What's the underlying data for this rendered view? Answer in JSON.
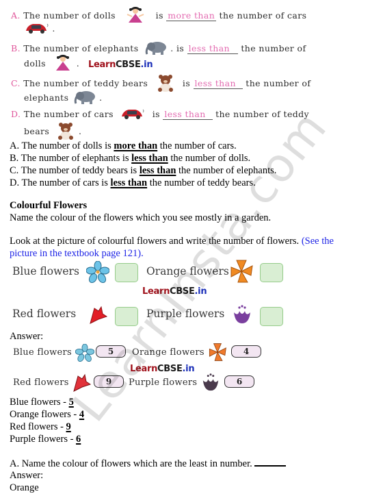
{
  "comparison_questions": [
    {
      "letter": "A.",
      "pre": "The number of dolls",
      "is": "is",
      "fill": "more than",
      "post": "the number of cars",
      "tail": "."
    },
    {
      "letter": "B.",
      "pre": "The number of elephants",
      "is": ". is",
      "fill": "less than",
      "post": "the number of",
      "line2": "dolls",
      "tail": "."
    },
    {
      "letter": "C.",
      "pre": "The number of teddy bears",
      "is": "is",
      "fill": "less than",
      "post": "the number of",
      "line2": "elephants",
      "tail": "."
    },
    {
      "letter": "D.",
      "pre": "The number of cars",
      "is": "is",
      "fill": "less than",
      "post": "the number of teddy",
      "line2": "bears",
      "tail": "."
    }
  ],
  "watermark_logo": {
    "part1": "Learn",
    "part2": "CBSE",
    "part3": ".in"
  },
  "comparison_answers": [
    {
      "pre": "A. The number of dolls is ",
      "ans": "more than",
      "post": " the number of cars."
    },
    {
      "pre": "B. The number of elephants is ",
      "ans": "less than",
      "post": " the number of dolls."
    },
    {
      "pre": "C. The number of teddy bears is ",
      "ans": "less than",
      "post": " the number of elephants."
    },
    {
      "pre": "D. The number of cars is ",
      "ans": "less than",
      "post": " the number of teddy bears."
    }
  ],
  "flowers_section": {
    "heading": "Colourful Flowers",
    "prompt": "Name the colour of the flowers which you see mostly in a garden.",
    "instruction": "Look at the picture of colourful flowers and write the number of flowers.",
    "reference_line1": "(See the",
    "reference_line2": "picture in the textbook page 121)."
  },
  "flower_question": {
    "blue": "Blue flowers",
    "orange": "Orange flowers",
    "red": "Red flowers",
    "purple": "Purple flowers"
  },
  "answer_label": "Answer:",
  "flower_answer_image": {
    "blue": {
      "label": "Blue flowers",
      "count": "5"
    },
    "orange": {
      "label": "Orange flowers",
      "count": "4"
    },
    "red": {
      "label": "Red flowers",
      "count": "9"
    },
    "purple": {
      "label": "Purple flowers",
      "count": "6"
    }
  },
  "flower_counts": [
    {
      "label": "Blue flowers - ",
      "value": "5"
    },
    {
      "label": "Orange flowers - ",
      "value": "4"
    },
    {
      "label": "Red flowers - ",
      "value": "9"
    },
    {
      "label": "Purple flowers - ",
      "value": "6"
    }
  ],
  "least_question": {
    "text": "A. Name the colour of flowers which are the least in number.",
    "answer_label": "Answer:",
    "answer": "Orange"
  },
  "site_watermark": "LearnInsta.com"
}
